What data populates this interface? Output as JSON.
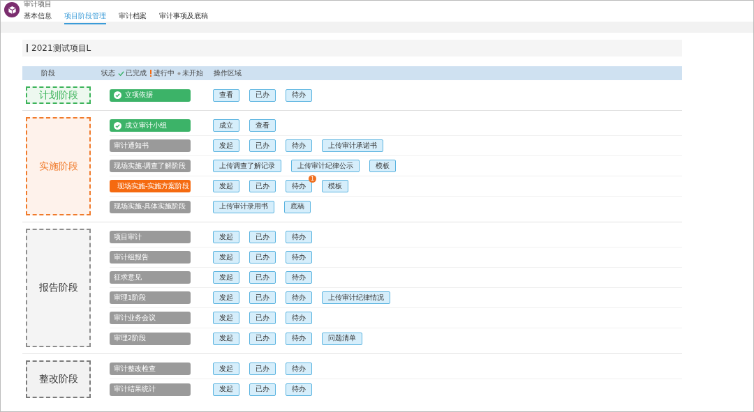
{
  "app": {
    "title": "审计项目"
  },
  "tabs": [
    {
      "label": "基本信息",
      "selected": false
    },
    {
      "label": "项目阶段管理",
      "selected": true
    },
    {
      "label": "审计档案",
      "selected": false
    },
    {
      "label": "审计事项及底稿",
      "selected": false
    }
  ],
  "project": {
    "title": "2021测试项目L"
  },
  "table_header": {
    "stage": "阶段",
    "status": "状态",
    "actions": "操作区域",
    "legend": [
      {
        "label": "已完成",
        "kind": "done"
      },
      {
        "label": "进行中",
        "kind": "active"
      },
      {
        "label": "未开始",
        "kind": "pending"
      }
    ]
  },
  "stages": [
    {
      "name": "计划阶段",
      "color": "#3cb35a",
      "tasks": [
        {
          "label": "立项依据",
          "kind": "done",
          "actions": [
            {
              "label": "查看"
            },
            {
              "label": "已办"
            },
            {
              "label": "待办"
            }
          ]
        }
      ]
    },
    {
      "name": "实施阶段",
      "color": "#f07a2a",
      "tasks": [
        {
          "label": "成立审计小组",
          "kind": "done",
          "actions": [
            {
              "label": "成立"
            },
            {
              "label": "查看"
            }
          ]
        },
        {
          "label": "审计通知书",
          "kind": "pending",
          "actions": [
            {
              "label": "发起"
            },
            {
              "label": "已办"
            },
            {
              "label": "待办"
            },
            {
              "label": "上传审计承诺书"
            }
          ]
        },
        {
          "label": "现场实施-调查了解阶段",
          "kind": "pending",
          "actions": [
            {
              "label": "上传调查了解记录"
            },
            {
              "label": "上传审计纪律公示"
            },
            {
              "label": "模板"
            }
          ]
        },
        {
          "label": "现场实施-实施方案阶段",
          "kind": "active",
          "actions": [
            {
              "label": "发起"
            },
            {
              "label": "已办"
            },
            {
              "label": "待办",
              "badge": "1"
            },
            {
              "label": "模板"
            }
          ]
        },
        {
          "label": "现场实施-具体实施阶段",
          "kind": "pending",
          "actions": [
            {
              "label": "上传审计录用书"
            },
            {
              "label": "底稿"
            }
          ]
        }
      ]
    },
    {
      "name": "报告阶段",
      "color": "#8c8c8c",
      "tasks": [
        {
          "label": "项目审计",
          "kind": "pending",
          "actions": [
            {
              "label": "发起"
            },
            {
              "label": "已办"
            },
            {
              "label": "待办"
            }
          ]
        },
        {
          "label": "审计组报告",
          "kind": "pending",
          "actions": [
            {
              "label": "发起"
            },
            {
              "label": "已办"
            },
            {
              "label": "待办"
            }
          ]
        },
        {
          "label": "征求意见",
          "kind": "pending",
          "actions": [
            {
              "label": "发起"
            },
            {
              "label": "已办"
            },
            {
              "label": "待办"
            }
          ]
        },
        {
          "label": "审理1阶段",
          "kind": "pending",
          "actions": [
            {
              "label": "发起"
            },
            {
              "label": "已办"
            },
            {
              "label": "待办"
            },
            {
              "label": "上传审计纪律情况"
            }
          ]
        },
        {
          "label": "审计业务会议",
          "kind": "pending",
          "actions": [
            {
              "label": "发起"
            },
            {
              "label": "已办"
            },
            {
              "label": "待办"
            }
          ]
        },
        {
          "label": "审理2阶段",
          "kind": "pending",
          "actions": [
            {
              "label": "发起"
            },
            {
              "label": "已办"
            },
            {
              "label": "待办"
            },
            {
              "label": "问题清单"
            }
          ]
        }
      ]
    },
    {
      "name": "整改阶段",
      "color": "#7a7a7a",
      "tasks": [
        {
          "label": "审计整改检查",
          "kind": "pending",
          "actions": [
            {
              "label": "发起"
            },
            {
              "label": "已办"
            },
            {
              "label": "待办"
            }
          ]
        },
        {
          "label": "审计结果统计",
          "kind": "pending",
          "actions": [
            {
              "label": "发起"
            },
            {
              "label": "已办"
            },
            {
              "label": "待办"
            }
          ]
        }
      ]
    }
  ]
}
